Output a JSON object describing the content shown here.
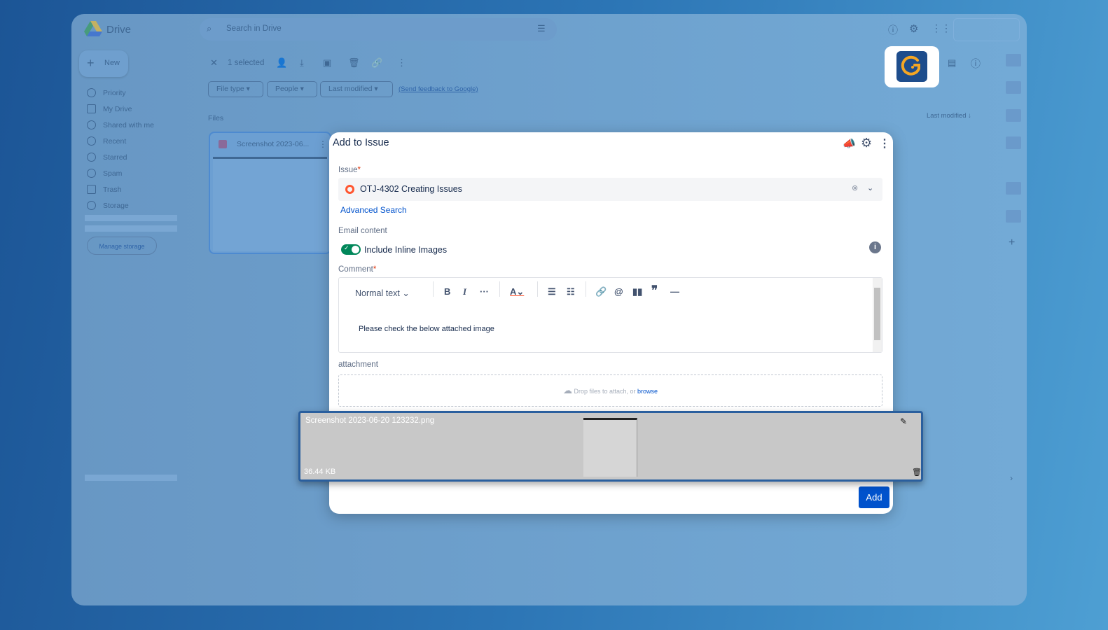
{
  "drive": {
    "app_name": "Drive",
    "search_placeholder": "Search in Drive",
    "new_label": "New",
    "sidebar": [
      {
        "label": "Priority"
      },
      {
        "label": "My Drive"
      },
      {
        "label": "Shared with me"
      },
      {
        "label": "Recent"
      },
      {
        "label": "Starred"
      },
      {
        "label": "Spam"
      },
      {
        "label": "Trash"
      },
      {
        "label": "Storage"
      }
    ],
    "manage_storage": "Manage storage",
    "selected": "1 selected",
    "filters": [
      "File type",
      "People",
      "Last modified"
    ],
    "feedback": "(Send feedback to Google)",
    "files_heading": "Files",
    "file_name": "Screenshot 2023-06...",
    "sort_label": "Last modified"
  },
  "modal": {
    "title": "Add to Issue",
    "issue_label": "Issue",
    "issue_value": "OTJ-4302 Creating Issues",
    "advanced_search": "Advanced Search",
    "email_content_label": "Email content",
    "toggle_label": "Include Inline Images",
    "toggle_on": true,
    "comment_label": "Comment",
    "text_style": "Normal text",
    "comment_text": "Please check the below attached image",
    "attachment_label": "attachment",
    "drop_text": "Drop files to attach, or ",
    "browse": "browse",
    "add_button": "Add"
  },
  "attachment": {
    "file_name": "Screenshot 2023-06-20 123232.png",
    "size": "36.44 KB"
  },
  "colors": {
    "accent": "#0052cc",
    "toggle": "#00875a",
    "issue_icon": "#ff5630"
  }
}
